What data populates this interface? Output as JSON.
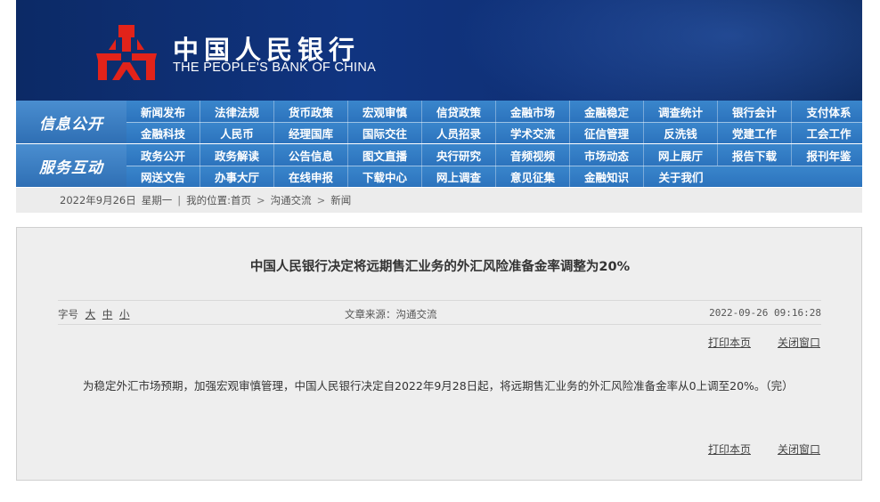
{
  "header": {
    "brand_cn": "中国人民银行",
    "brand_en": "THE PEOPLE'S BANK OF CHINA",
    "logo_color": "#e2231a",
    "bg_color": "#0f2f73"
  },
  "nav": {
    "section1_label": "信息公开",
    "section1_row1": [
      "新闻发布",
      "法律法规",
      "货币政策",
      "宏观审慎",
      "信贷政策",
      "金融市场",
      "金融稳定",
      "调查统计",
      "银行会计",
      "支付体系"
    ],
    "section1_row2": [
      "金融科技",
      "人民币",
      "经理国库",
      "国际交往",
      "人员招录",
      "学术交流",
      "征信管理",
      "反洗钱",
      "党建工作",
      "工会工作"
    ],
    "section2_label": "服务互动",
    "section2_row1": [
      "政务公开",
      "政务解读",
      "公告信息",
      "图文直播",
      "央行研究",
      "音频视频",
      "市场动态",
      "网上展厅",
      "报告下载",
      "报刊年鉴"
    ],
    "section2_row2": [
      "网送文告",
      "办事大厅",
      "在线申报",
      "下载中心",
      "网上调查",
      "意见征集",
      "金融知识",
      "关于我们"
    ],
    "accent_color": "#2f78c0"
  },
  "breadcrumb": {
    "date": "2022年9月26日",
    "weekday": "星期一",
    "sep": "|",
    "location_label": "我的位置:首页",
    "arrow": ">",
    "level1": "沟通交流",
    "level2": "新闻"
  },
  "article": {
    "title": "中国人民银行决定将远期售汇业务的外汇风险准备金率调整为20%",
    "font_label": "字号",
    "font_large": "大",
    "font_medium": "中",
    "font_small": "小",
    "source": "文章来源：沟通交流",
    "datetime": "2022-09-26 09:16:28",
    "print_label": "打印本页",
    "close_label": "关闭窗口",
    "body": "为稳定外汇市场预期，加强宏观审慎管理，中国人民银行决定自2022年9月28日起，将远期售汇业务的外汇风险准备金率从0上调至20%。（完）"
  }
}
